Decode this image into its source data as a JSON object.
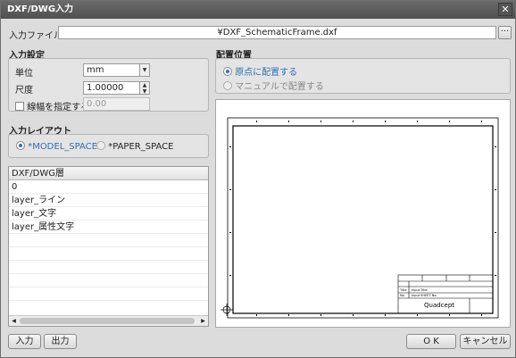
{
  "window": {
    "title": "DXF/DWG入力",
    "close_glyph": "✕"
  },
  "file": {
    "label": "入力ファイル",
    "value": "¥DXF_SchematicFrame.dxf",
    "browse_label": "···"
  },
  "input_settings": {
    "heading": "入力設定",
    "unit_label": "単位",
    "unit_value": "mm",
    "scale_label": "尺度",
    "scale_value": "1.00000",
    "line_width_label": "線幅を指定する",
    "line_width_value": "0.00"
  },
  "layout": {
    "heading": "入力レイアウト",
    "model_space": "*MODEL_SPACE",
    "paper_space": "*PAPER_SPACE"
  },
  "layers": {
    "header": "DXF/DWG層",
    "items": [
      "0",
      "layer_ライン",
      "layer_文字",
      "layer_属性文字"
    ]
  },
  "placement": {
    "heading": "配置位置",
    "origin_option": "原点に配置する",
    "manual_option": "マニュアルで配置する"
  },
  "preview": {
    "title_block_title_label": "Title",
    "title_block_title_value": "Input Title",
    "title_block_no_label": "No.",
    "title_block_no_value": "Input SHEET No.",
    "title_block_brand": "Quadcept"
  },
  "buttons": {
    "input": "入力",
    "output": "出力",
    "ok": "O K",
    "cancel": "キャンセル"
  },
  "colors": {
    "titlebar": "#555555",
    "accent": "#2f6fb5",
    "background": "#dcdcdc"
  }
}
